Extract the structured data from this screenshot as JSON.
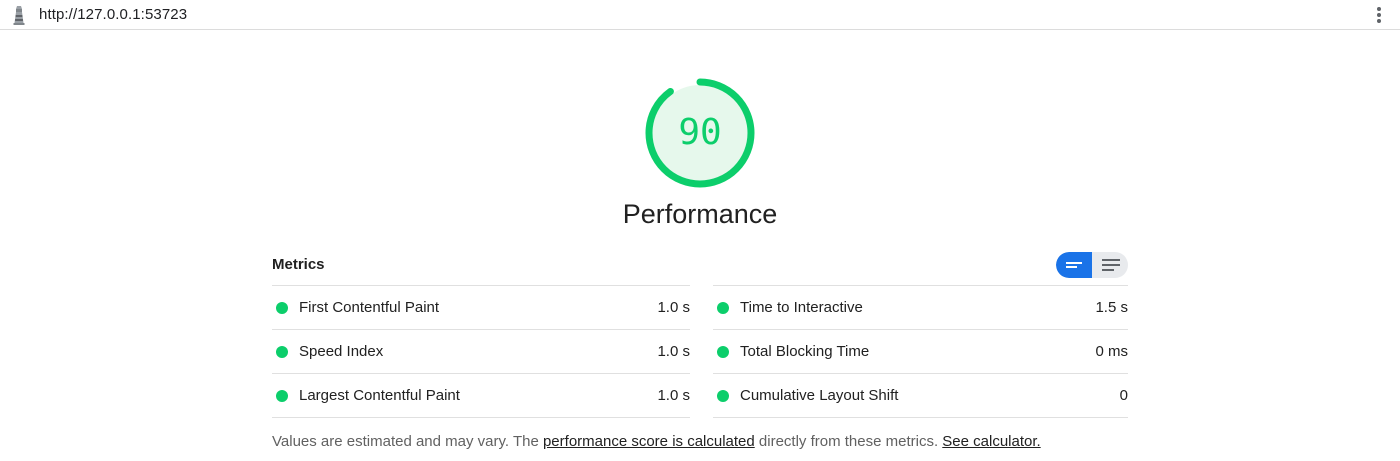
{
  "browser": {
    "url": "http://127.0.0.1:53723",
    "app_icon": "lighthouse-icon",
    "menu_icon": "kebab-menu-icon"
  },
  "gauge": {
    "score": "90",
    "fraction": 0.9,
    "color": "#0cce6b",
    "track_color": "#e6f8ec",
    "title": "Performance"
  },
  "metrics": {
    "header": "Metrics",
    "toggle": {
      "active": "table-view",
      "options": [
        "table-view-icon",
        "list-view-icon"
      ],
      "accent": "#1a73e8"
    },
    "left": [
      {
        "label": "First Contentful Paint",
        "value": "1.0 s",
        "status": "pass"
      },
      {
        "label": "Speed Index",
        "value": "1.0 s",
        "status": "pass"
      },
      {
        "label": "Largest Contentful Paint",
        "value": "1.0 s",
        "status": "pass"
      }
    ],
    "right": [
      {
        "label": "Time to Interactive",
        "value": "1.5 s",
        "status": "pass"
      },
      {
        "label": "Total Blocking Time",
        "value": "0 ms",
        "status": "pass"
      },
      {
        "label": "Cumulative Layout Shift",
        "value": "0",
        "status": "pass"
      }
    ],
    "pass_color": "#0cce6b"
  },
  "footnote": {
    "prefix": "Values are estimated and may vary. The ",
    "link1": "performance score is calculated",
    "middle": " directly from these metrics. ",
    "link2": "See calculator."
  }
}
